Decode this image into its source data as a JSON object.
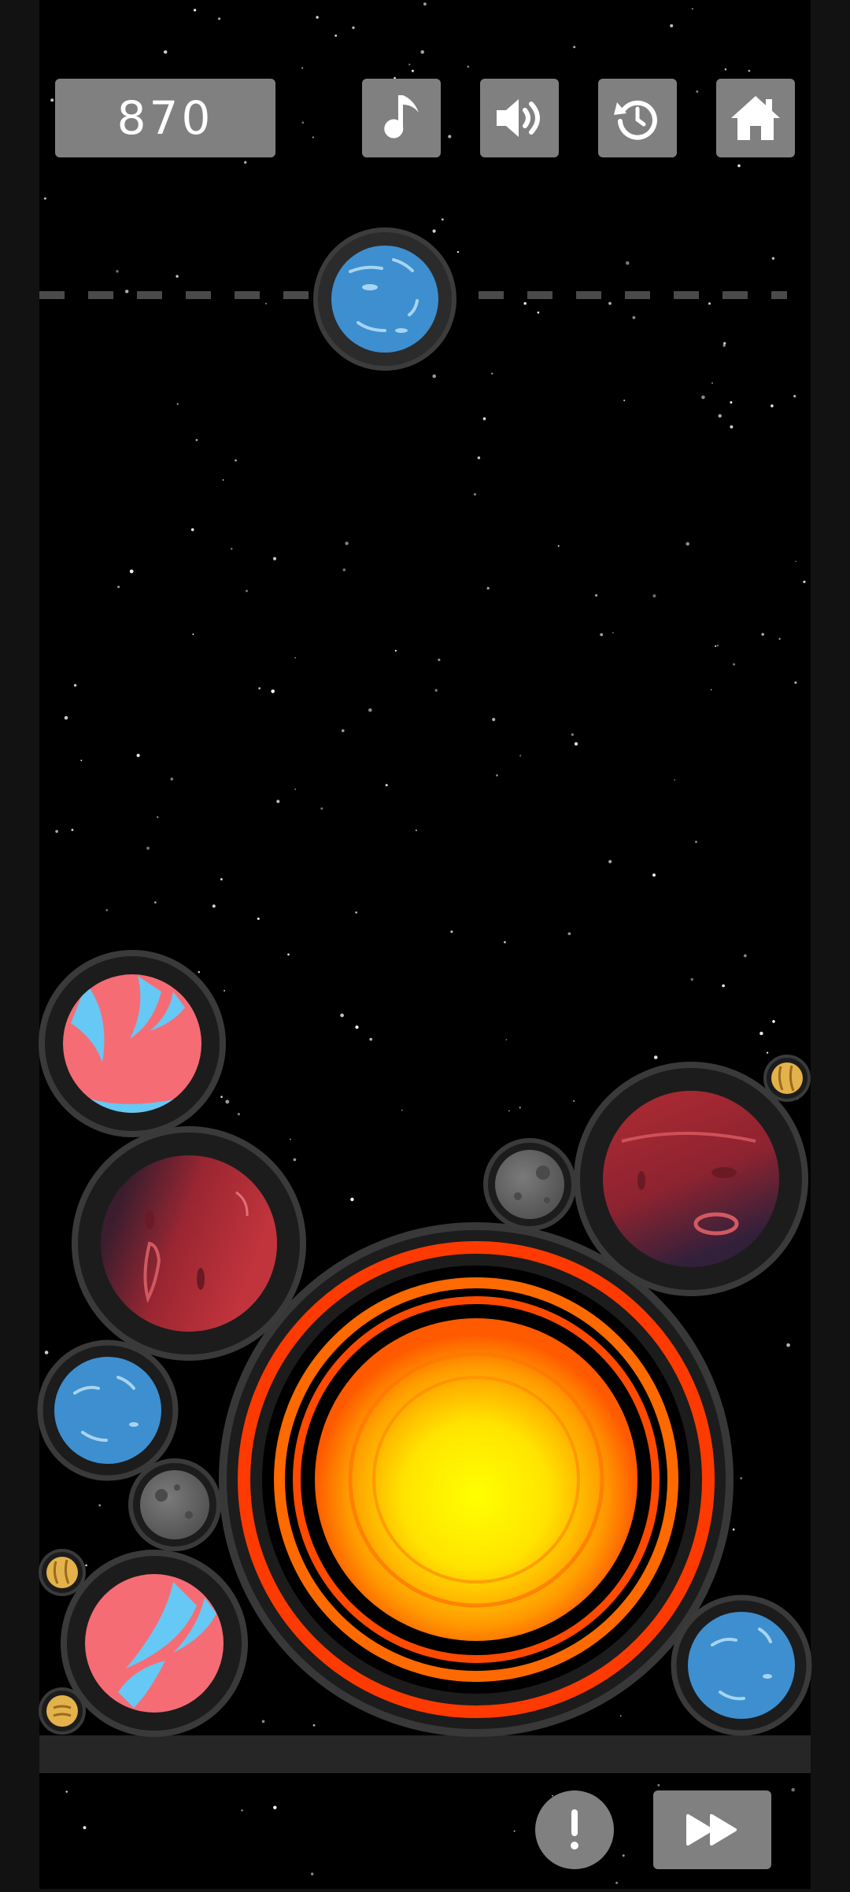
{
  "hud": {
    "score": "870",
    "buttons": [
      {
        "name": "music-toggle-button",
        "icon": "music-note-icon"
      },
      {
        "name": "sound-toggle-button",
        "icon": "speaker-icon"
      },
      {
        "name": "restart-button",
        "icon": "restart-icon"
      },
      {
        "name": "home-button",
        "icon": "home-icon"
      }
    ]
  },
  "bottom_bar": {
    "info_icon": "exclamation-icon",
    "fast_forward_icon": "fast-forward-icon"
  },
  "next_planet": "neptune",
  "planets_on_board": [
    "sun",
    "mars",
    "mars",
    "earth",
    "earth",
    "neptune",
    "neptune",
    "moon",
    "moon",
    "pluto",
    "pluto",
    "pluto"
  ],
  "colors": {
    "background": "#000000",
    "frame": "#141414",
    "hud_button": "#808080",
    "dashed_line": "#4a4a4a",
    "floor": "#262626"
  }
}
